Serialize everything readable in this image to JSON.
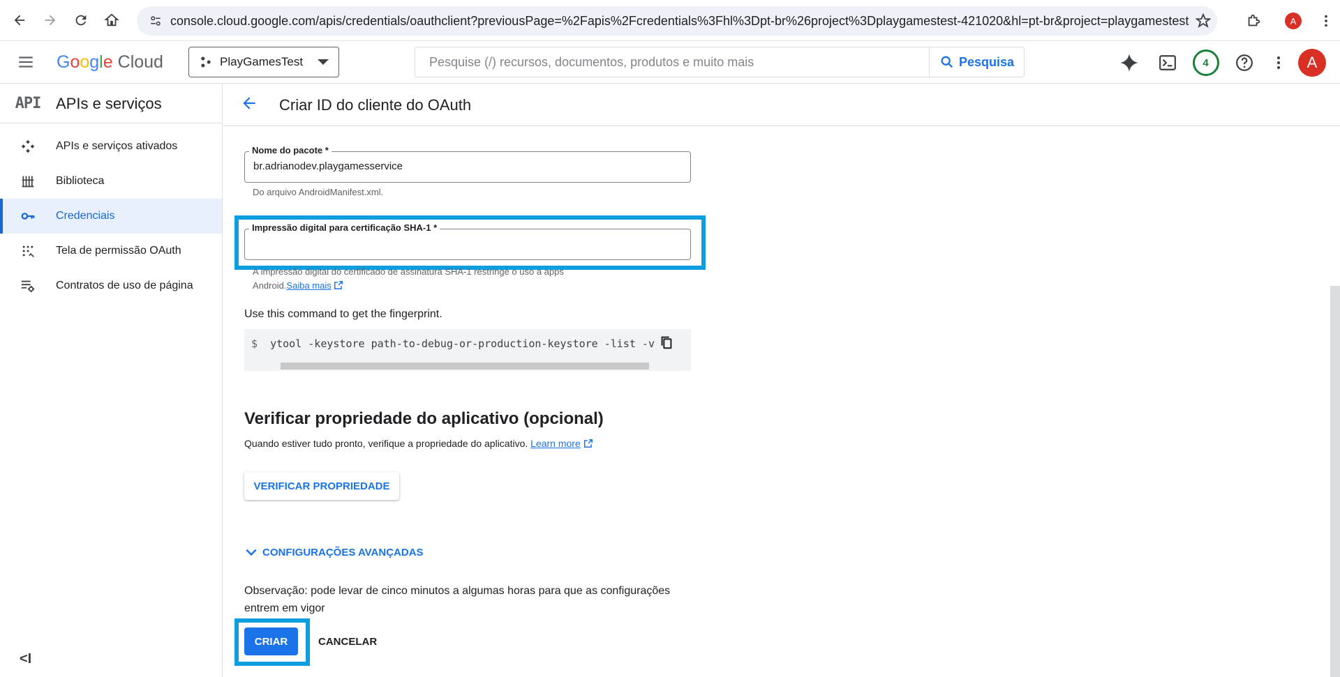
{
  "browser": {
    "url": "console.cloud.google.com/apis/credentials/oauthclient?previousPage=%2Fapis%2Fcredentials%3Fhl%3Dpt-br%26project%3Dplaygamestest-421020&hl=pt-br&project=playgamestest-42...",
    "profile_initial": "A"
  },
  "header": {
    "logo_letters": [
      "G",
      "o",
      "o",
      "g",
      "l",
      "e"
    ],
    "logo_product": "Cloud",
    "project_name": "PlayGamesTest",
    "search_placeholder": "Pesquise (/) recursos, documentos, produtos e muito mais",
    "search_button": "Pesquisa",
    "notification_count": "4",
    "avatar_initial": "A"
  },
  "sidebar": {
    "logo_text": "API",
    "title": "APIs e serviços",
    "items": [
      {
        "label": "APIs e serviços ativados",
        "icon": "diamond-nodes-icon"
      },
      {
        "label": "Biblioteca",
        "icon": "library-icon"
      },
      {
        "label": "Credenciais",
        "icon": "key-icon",
        "active": true
      },
      {
        "label": "Tela de permissão OAuth",
        "icon": "consent-grid-icon"
      },
      {
        "label": "Contratos de uso de página",
        "icon": "settings-list-icon"
      }
    ],
    "collapse_symbol": "<I"
  },
  "page": {
    "title": "Criar ID do cliente do OAuth",
    "package_field": {
      "label": "Nome do pacote *",
      "value": "br.adrianodev.playgamesservice",
      "hint": "Do arquivo AndroidManifest.xml."
    },
    "sha1_field": {
      "label": "Impressão digital para certificação SHA-1 *",
      "value": "",
      "hint_line1": "A impressão digital do certificado de assinatura SHA-1 restringe o uso a apps",
      "hint_line2": "Android.",
      "hint_link": "Saiba mais"
    },
    "command_label": "Use this command to get the fingerprint.",
    "command_prompt": "$",
    "command": "ytool -keystore path-to-debug-or-production-keystore -list -v",
    "verify_section": {
      "title": "Verificar propriedade do aplicativo (opcional)",
      "description": "Quando estiver tudo pronto, verifique a propriedade do aplicativo.",
      "link": "Learn more",
      "button": "VERIFICAR PROPRIEDADE"
    },
    "advanced_toggle": "CONFIGURAÇÕES AVANÇADAS",
    "note": "Observação: pode levar de cinco minutos a algumas horas para que as configurações entrem em vigor",
    "create_button": "CRIAR",
    "cancel_button": "CANCELAR"
  },
  "colors": {
    "accent": "#1a73e8",
    "highlight_frame": "#0d9ee0",
    "active_nav_bg": "#e8f0fe"
  }
}
